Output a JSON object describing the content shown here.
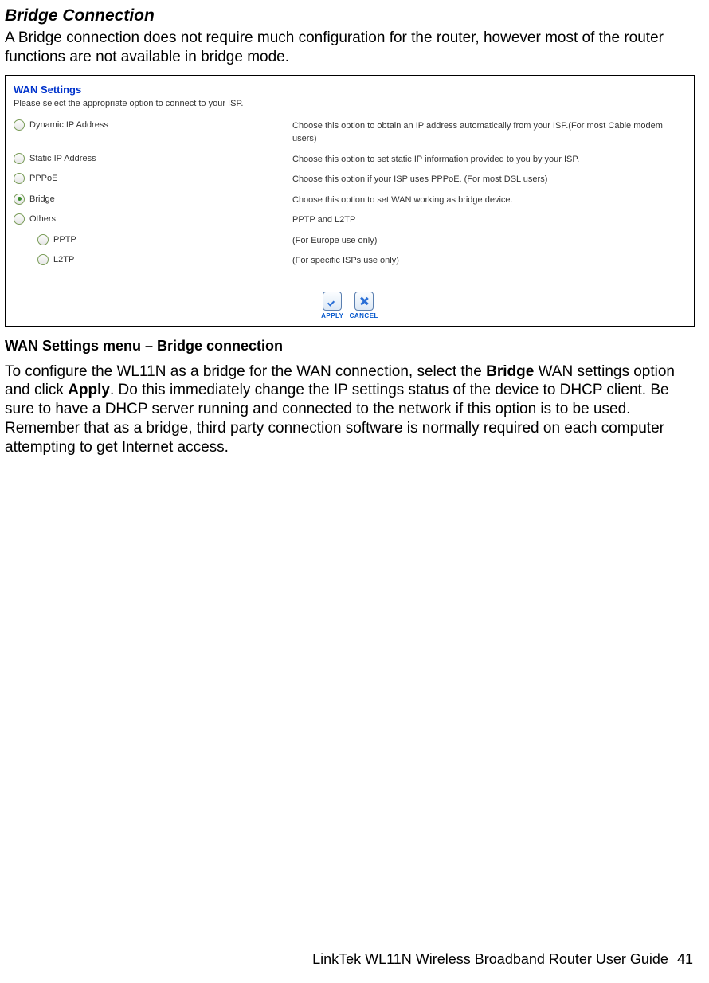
{
  "section_title": "Bridge Connection",
  "intro": "A Bridge connection does not require much configuration for the router, however most of the router functions are not available in bridge mode.",
  "panel": {
    "title": "WAN Settings",
    "subtitle": "Please select the appropriate option to connect to your ISP.",
    "options": [
      {
        "label": "Dynamic IP Address",
        "desc": "Choose this option to obtain an IP address automatically from your ISP.(For most Cable modem users)",
        "selected": false,
        "indent": false
      },
      {
        "label": "Static IP Address",
        "desc": "Choose this option to set static IP information provided to you by your ISP.",
        "selected": false,
        "indent": false
      },
      {
        "label": "PPPoE",
        "desc": "Choose this option if your ISP uses PPPoE. (For most DSL users)",
        "selected": false,
        "indent": false
      },
      {
        "label": "Bridge",
        "desc": "Choose this option to set WAN working as bridge device.",
        "selected": true,
        "indent": false
      },
      {
        "label": "Others",
        "desc": "PPTP and L2TP",
        "selected": false,
        "indent": false
      },
      {
        "label": "PPTP",
        "desc": "(For Europe use only)",
        "selected": false,
        "indent": true
      },
      {
        "label": "L2TP",
        "desc": "(For specific ISPs use only)",
        "selected": false,
        "indent": true
      }
    ],
    "apply_label": "APPLY",
    "cancel_label": "CANCEL"
  },
  "caption": "WAN Settings menu – Bridge connection",
  "body_pre": "To configure the WL11N as a bridge for the WAN connection, select the ",
  "body_bold1": "Bridge",
  "body_mid": " WAN settings option and click ",
  "body_bold2": "Apply",
  "body_post": ". Do this immediately change the IP settings status of the device to DHCP client. Be sure to have a DHCP server running and connected to the network if this option is to be used. Remember that as a bridge, third party connection software is normally required on each computer attempting to get Internet access.",
  "footer_text": "LinkTek WL11N Wireless Broadband Router User Guide",
  "page_number": "41"
}
